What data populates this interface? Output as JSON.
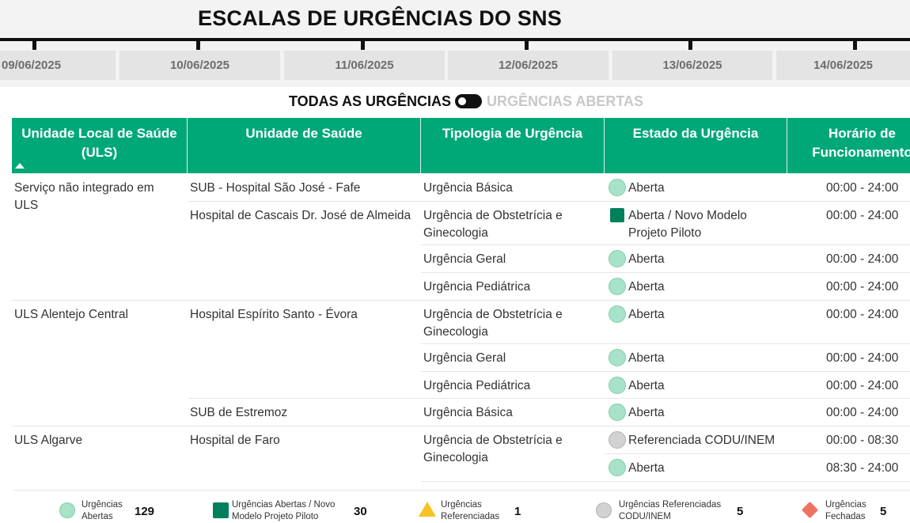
{
  "page_title": "ESCALAS DE URGÊNCIAS DO SNS",
  "dates": [
    "09/06/2025",
    "10/06/2025",
    "11/06/2025",
    "12/06/2025",
    "13/06/2025",
    "14/06/2025"
  ],
  "toggle": {
    "left_label": "TODAS AS URGÊNCIAS",
    "right_label": "URGÊNCIAS ABERTAS"
  },
  "table": {
    "headers": [
      "Unidade Local de Saúde (ULS)",
      "Unidade de Saúde",
      "Tipologia de Urgência",
      "Estado da Urgência",
      "Horário de Funcionamento"
    ],
    "rows": [
      {
        "uls": "Serviço não integrado em ULS",
        "unit": "SUB - Hospital São José - Fafe",
        "type": "Urgência Básica",
        "status": "Aberta",
        "hours": "00:00 - 24:00"
      },
      {
        "uls": "",
        "unit": "Hospital de Cascais Dr. José de Almeida",
        "type": "Urgência de Obstetrícia e Ginecologia",
        "status": "Aberta / Novo Modelo Projeto Piloto",
        "hours": "00:00 - 24:00"
      },
      {
        "uls": "",
        "unit": "",
        "type": "Urgência Geral",
        "status": "Aberta",
        "hours": "00:00 - 24:00"
      },
      {
        "uls": "",
        "unit": "",
        "type": "Urgência Pediátrica",
        "status": "Aberta",
        "hours": "00:00 - 24:00"
      },
      {
        "uls": "ULS Alentejo Central",
        "unit": "Hospital Espírito Santo - Évora",
        "type": "Urgência de Obstetrícia e Ginecologia",
        "status": "Aberta",
        "hours": "00:00 - 24:00"
      },
      {
        "uls": "",
        "unit": "",
        "type": "Urgência Geral",
        "status": "Aberta",
        "hours": "00:00 - 24:00"
      },
      {
        "uls": "",
        "unit": "",
        "type": "Urgência Pediátrica",
        "status": "Aberta",
        "hours": "00:00 - 24:00"
      },
      {
        "uls": "",
        "unit": "SUB de Estremoz",
        "type": "Urgência Básica",
        "status": "Aberta",
        "hours": "00:00 - 24:00"
      },
      {
        "uls": "ULS Algarve",
        "unit": "Hospital de Faro",
        "type": "Urgência de Obstetrícia e Ginecologia",
        "status": "Referenciada CODU/INEM",
        "hours": "00:00 - 08:30"
      },
      {
        "uls": "",
        "unit": "",
        "type": "",
        "status": "Aberta",
        "hours": "08:30 - 24:00"
      }
    ]
  },
  "legend": [
    {
      "label": "Urgências Abertas",
      "count": "129",
      "icon": "open-circle-icon",
      "color": "#a8e2c8"
    },
    {
      "label": "Urgências Abertas / Novo Modelo Projeto Piloto",
      "count": "30",
      "icon": "pilot-square-icon",
      "color": "#00805a"
    },
    {
      "label": "Urgências Referenciadas",
      "count": "1",
      "icon": "warning-triangle-icon",
      "color": "#f6c325"
    },
    {
      "label": "Urgências Referenciadas CODU/INEM",
      "count": "5",
      "icon": "grey-circle-icon",
      "color": "#d2d2d2"
    },
    {
      "label": "Urgências Fechadas",
      "count": "5",
      "icon": "closed-diamond-icon",
      "color": "#f07362"
    }
  ],
  "colors": {
    "header_green": "#00a878",
    "pilot_green": "#00805a",
    "open_green": "#a8e2c8"
  }
}
